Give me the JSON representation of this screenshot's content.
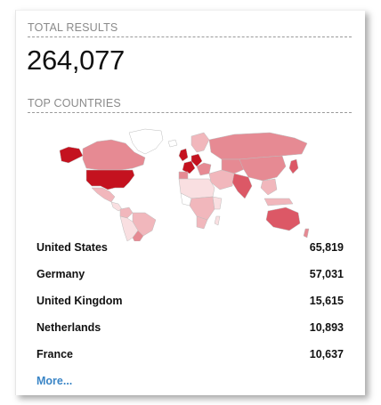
{
  "total": {
    "heading": "TOTAL RESULTS",
    "value": "264,077"
  },
  "countries": {
    "heading": "TOP COUNTRIES",
    "items": [
      {
        "name": "United States",
        "count": "65,819"
      },
      {
        "name": "Germany",
        "count": "57,031"
      },
      {
        "name": "United Kingdom",
        "count": "15,615"
      },
      {
        "name": "Netherlands",
        "count": "10,893"
      },
      {
        "name": "France",
        "count": "10,637"
      }
    ],
    "more_label": "More..."
  },
  "map_colors": {
    "darkest": "#c4121f",
    "dark": "#dc5866",
    "medium": "#e68a93",
    "light": "#f1b7bc",
    "lightest": "#f9dfe1",
    "border": "#bdbdbd"
  }
}
